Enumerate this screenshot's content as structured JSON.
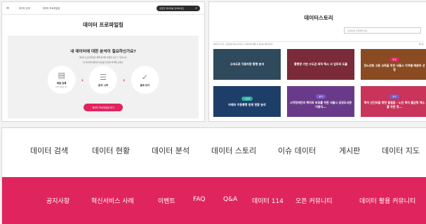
{
  "profiling": {
    "header": {
      "nav_a": "데이터 검색",
      "nav_b": "데이터 프로파일링",
      "search_placeholder": "궁금한 데이터를 검색하세요"
    },
    "title": "데이터 프로파일링",
    "question": "내 데이터에 대한 분석이 필요하신가요?",
    "desc_1": "데이터 프로파일링을 통해 분석의 방향을 잡을 수 있습니다.",
    "desc_2": "내 데이터의 품질과 분포를 한눈에 파악해 보세요.",
    "steps": [
      {
        "label": "파일 등록",
        "sub": "CSV 파일만 가능",
        "icon": "file-icon"
      },
      {
        "label": "분석 시작",
        "sub": "",
        "icon": "document-icon"
      },
      {
        "label": "결과 보기",
        "sub": "",
        "icon": "check-icon"
      }
    ],
    "cta": "데이터 프로파일링 하기"
  },
  "story": {
    "title": "데이터스토리",
    "search_placeholder": "검색어를 입력해주세요.",
    "meta_left": "데이터스토리는 공공데이터를 분석하고 시각화하여 생활 속 정보를 제공합니다.",
    "meta_right": "최신순",
    "tiles": [
      {
        "tag": "",
        "title": "고속도로 이용차량 통행 분석",
        "bg": "#2f4a5c",
        "tag_color": ""
      },
      {
        "tag": "",
        "title": "통행량 기반 수도권 최적 택시 서 업무의 도출",
        "bg": "#7a2a38",
        "tag_color": ""
      },
      {
        "tag": "통계",
        "title": "장노년층 고용 교육을 위한 서울시 지역별 배분의 선정",
        "bg": "#8a4a22",
        "tag_color": "#e0245e"
      },
      {
        "tag": "시각화",
        "title": "카메라 이동통행 방제 현황 분석",
        "bg": "#1e3e6a",
        "tag_color": "#2bb0a0"
      },
      {
        "tag": "분석",
        "title": "시각장애인의 복지와 보호를 위한 서울시 공공도서관 이용자...",
        "bg": "#6a3a8a",
        "tag_color": "#7a5ac8"
      },
      {
        "tag": "분석",
        "title": "복지 선진국을 향한 발걸음 - 노인 복지 불균형 해소를 위한 정...",
        "bg": "#c8345a",
        "tag_color": "#7a5ac8"
      }
    ]
  },
  "main_nav": [
    "데이터 검색",
    "데이터 현황",
    "데이터 분석",
    "데이터 스토리",
    "이슈 데이터",
    "게시판",
    "데이터 지도"
  ],
  "sub_nav": [
    "공지사항",
    "혁신서비스 사례",
    "이벤트",
    "FAQ",
    "Q&A",
    "데이터 114",
    "오픈 커뮤니티",
    "데이터 활용 커뮤니티"
  ],
  "colors": {
    "accent": "#e0245e"
  }
}
